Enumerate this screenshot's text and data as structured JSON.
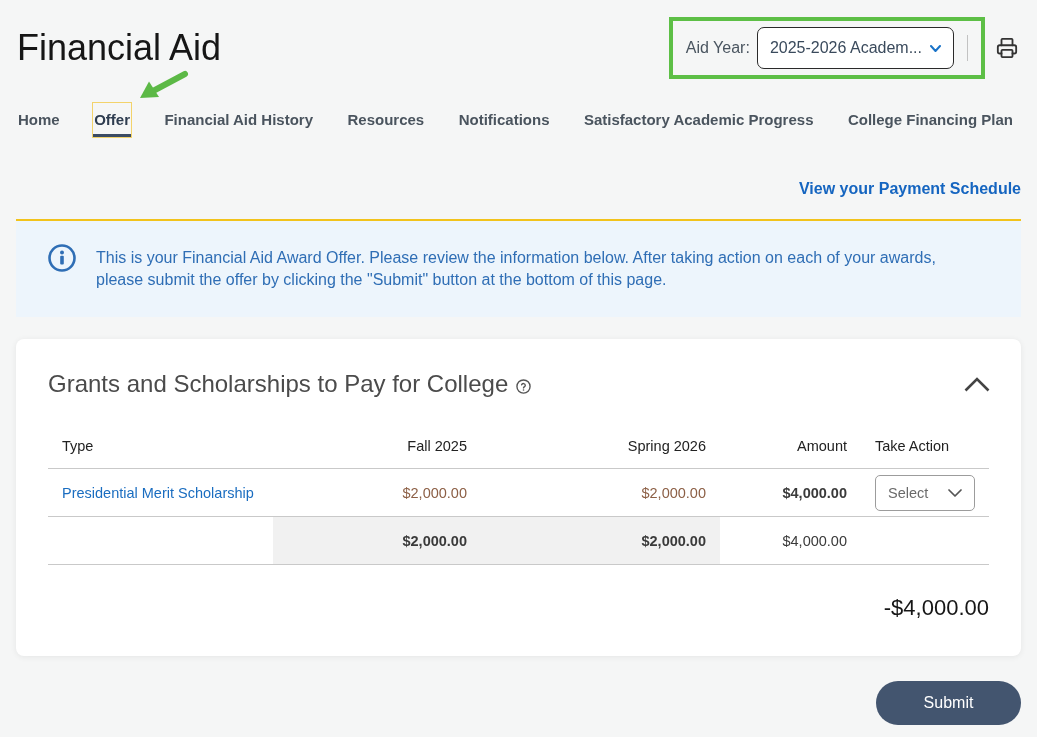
{
  "page": {
    "title": "Financial Aid"
  },
  "aid_year": {
    "label": "Aid Year:",
    "value": "2025-2026 Academ...",
    "highlighted": true
  },
  "tabs": [
    {
      "label": "Home",
      "selected": false,
      "pointed_at": false
    },
    {
      "label": "Offer",
      "selected": true,
      "pointed_at": true
    },
    {
      "label": "Financial Aid History",
      "selected": false,
      "pointed_at": false
    },
    {
      "label": "Resources",
      "selected": false,
      "pointed_at": false
    },
    {
      "label": "Notifications",
      "selected": false,
      "pointed_at": false
    },
    {
      "label": "Satisfactory Academic Progress",
      "selected": false,
      "pointed_at": false
    },
    {
      "label": "College Financing Plan",
      "selected": false,
      "pointed_at": false
    }
  ],
  "payment_schedule_link": "View your Payment Schedule",
  "notice": {
    "text": "This is your Financial Aid Award Offer. Please review the information below. After taking action on each of your awards, please submit the offer by clicking the \"Submit\" button at the bottom of this page."
  },
  "award_section": {
    "title": "Grants and Scholarships to Pay for College",
    "expanded": true,
    "table": {
      "columns": [
        "Type",
        "Fall 2025",
        "Spring 2026",
        "Amount",
        "Take Action"
      ],
      "rows": [
        {
          "type": "Presidential Merit Scholarship",
          "terms": [
            "$2,000.00",
            "$2,000.00"
          ],
          "amount": "$4,000.00",
          "action": {
            "placeholder": "Select"
          }
        }
      ],
      "totals": {
        "terms": [
          "$2,000.00",
          "$2,000.00"
        ],
        "amount": "$4,000.00"
      }
    },
    "balance": "-$4,000.00"
  },
  "buttons": [
    "Submit"
  ]
}
